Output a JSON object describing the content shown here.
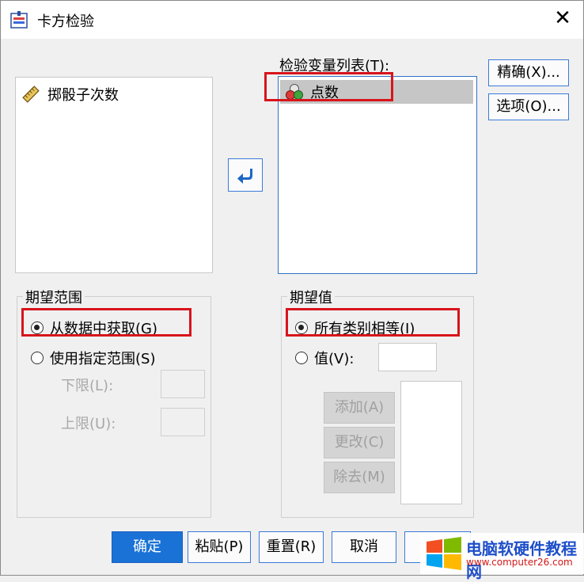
{
  "window": {
    "title": "卡方检验"
  },
  "source_list": {
    "items": [
      {
        "label": "掷骰子次数",
        "icon": "ruler-icon"
      }
    ]
  },
  "transfer_button": {
    "icon": "arrow-left-icon"
  },
  "test_list": {
    "label": "检验变量列表(T):",
    "items": [
      {
        "label": "点数",
        "icon": "nominal-variable-icon"
      }
    ]
  },
  "side_buttons": {
    "exact": "精确(X)...",
    "options": "选项(O)..."
  },
  "expected_range": {
    "title": "期望范围",
    "option_from_data": "从数据中获取(G)",
    "option_specified": "使用指定范围(S)",
    "lower_label": "下限(L):",
    "upper_label": "上限(U):",
    "selected": "从数据中获取(G)"
  },
  "expected_values": {
    "title": "期望值",
    "option_all_equal": "所有类别相等(I)",
    "option_values": "值(V):",
    "add": "添加(A)",
    "change": "更改(C)",
    "remove": "除去(M)",
    "selected": "所有类别相等(I)"
  },
  "footer": {
    "ok": "确定",
    "paste": "粘贴(P)",
    "reset": "重置(R)",
    "cancel": "取消"
  },
  "watermark": {
    "text": "电脑软硬件教程网",
    "url": "www.computer26.com"
  },
  "colors": {
    "highlight": "#d8141b",
    "primary": "#1a72d6",
    "accent_border": "#2e72c7"
  }
}
